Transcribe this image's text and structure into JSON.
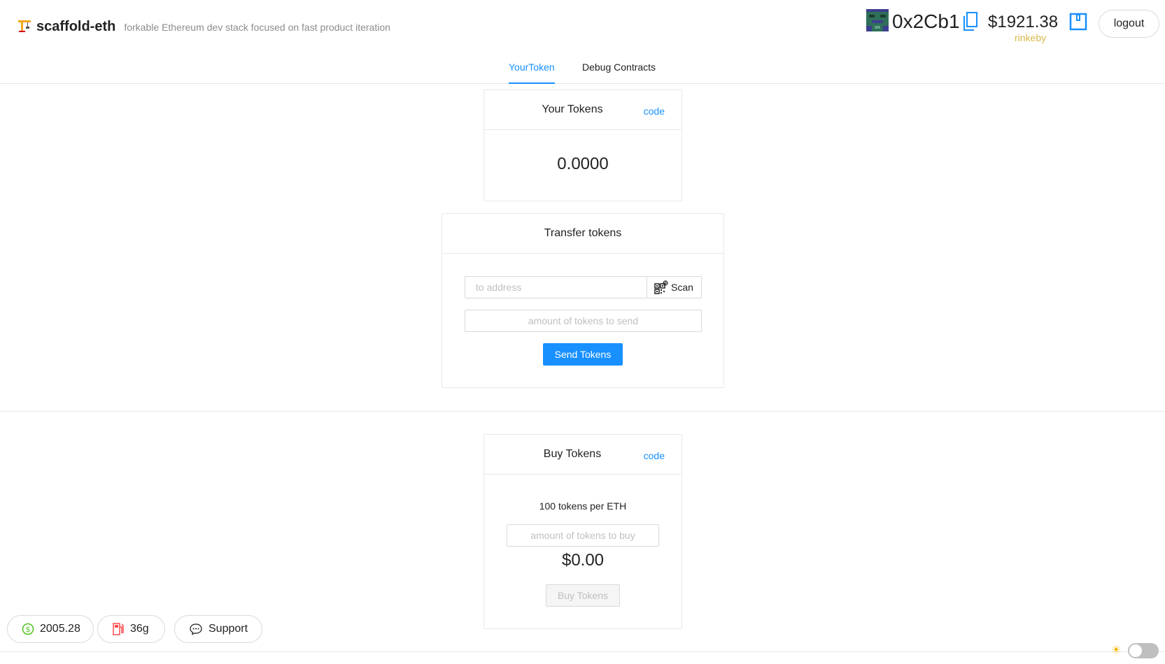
{
  "header": {
    "title": "scaffold-eth",
    "subtitle": "forkable Ethereum dev stack focused on fast product iteration",
    "brand_icon": "crane-icon"
  },
  "account": {
    "address": "0x2Cb1",
    "balance": "$1921.38",
    "network": "rinkeby",
    "logout_label": "logout"
  },
  "tabs": [
    {
      "label": "YourToken",
      "active": true
    },
    {
      "label": "Debug Contracts",
      "active": false
    }
  ],
  "your_tokens": {
    "title": "Your Tokens",
    "code_link": "code",
    "amount": "0.0000"
  },
  "transfer": {
    "title": "Transfer tokens",
    "address_placeholder": "to address",
    "scan_label": "Scan",
    "amount_placeholder": "amount of tokens to send",
    "send_label": "Send Tokens"
  },
  "buy": {
    "title": "Buy Tokens",
    "code_link": "code",
    "rate": "100 tokens per ETH",
    "amount_placeholder": "amount of tokens to buy",
    "price": "$0.00",
    "buy_label": "Buy Tokens"
  },
  "footer": {
    "eth_price": "2005.28",
    "gas": "36g",
    "support_label": "Support"
  },
  "colors": {
    "accent": "#1890ff",
    "network": "#d9b84a",
    "eth_price_icon": "#52c41a",
    "gas_icon": "#ff4d4f"
  }
}
